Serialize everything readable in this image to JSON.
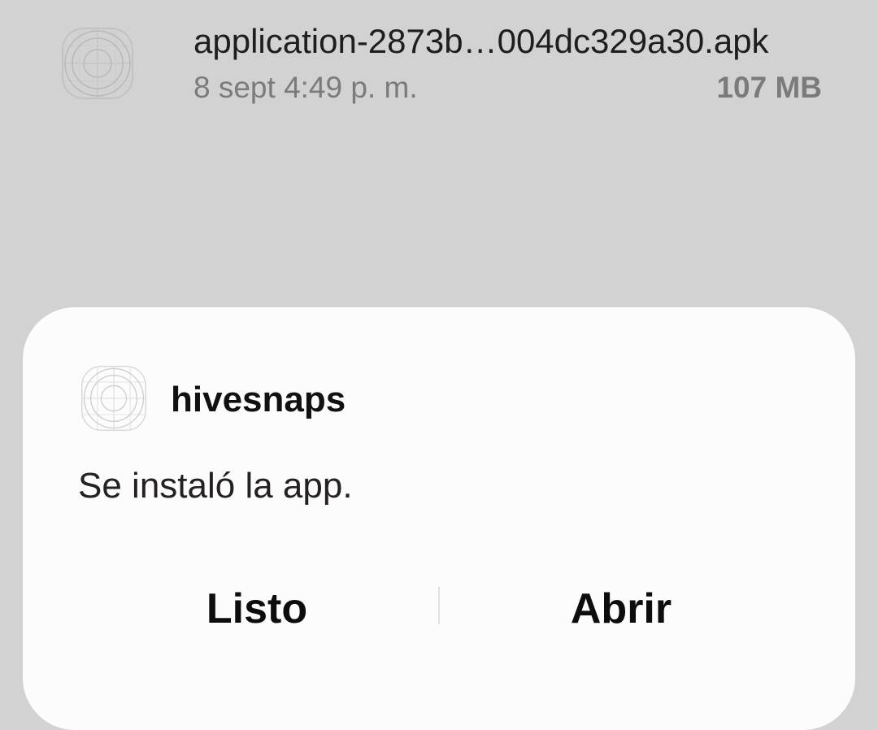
{
  "download": {
    "file_name": "application-2873b…004dc329a30.apk",
    "date": "8 sept 4:49 p. m.",
    "size": "107 MB",
    "icon": "apk-placeholder-icon"
  },
  "dialog": {
    "app_name": "hivesnaps",
    "app_icon": "app-placeholder-icon",
    "message": "Se instaló la app.",
    "done_label": "Listo",
    "open_label": "Abrir"
  },
  "colors": {
    "background": "#d2d2d2",
    "dialog_surface": "#fcfcfc",
    "primary_text": "#111111",
    "secondary_text": "#7b7b7b"
  }
}
